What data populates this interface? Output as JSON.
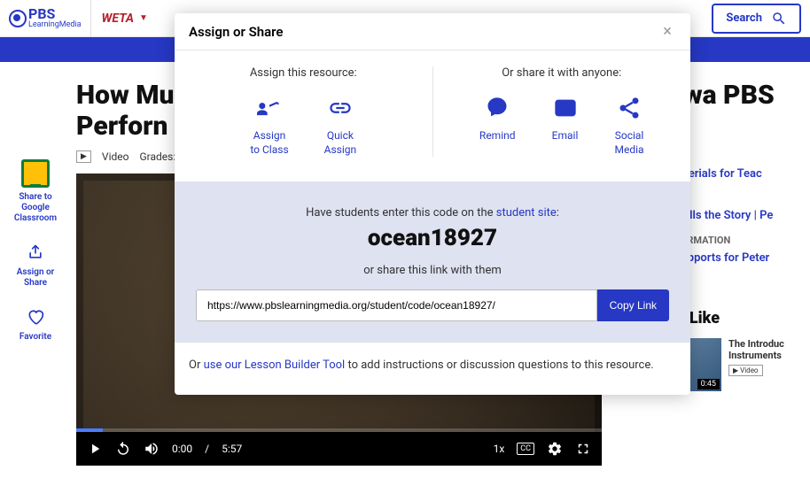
{
  "header": {
    "logo_main": "PBS",
    "logo_sub": "LearningMedia",
    "station": "WETA",
    "search": "Search"
  },
  "page": {
    "title_partial": "How Mu\nPerforn",
    "title_right": "owa PBS",
    "media_type": "Video",
    "grades_label": "Grades: P"
  },
  "left_sidebar": {
    "classroom": "Share to Google Classroom",
    "assign": "Assign or Share",
    "favorite": "Favorite"
  },
  "video": {
    "current_time": "0:00",
    "duration": "5:57",
    "speed": "1x",
    "cc": "CC"
  },
  "right_col": {
    "head1": "Materials for Teac",
    "link1": "c Tells the Story | Pe",
    "head2": "NFORMATION",
    "link2": "l Supports for Peter",
    "like_head": "so Like",
    "like_title": "The Introduc",
    "like_sub": "Instruments",
    "like_dur": "0:45",
    "like_type": "Video"
  },
  "modal": {
    "title": "Assign or Share",
    "col_left_head": "Assign this resource:",
    "col_right_head": "Or share it with anyone:",
    "options": {
      "assign": "Assign\nto Class",
      "quick": "Quick\nAssign",
      "remind": "Remind",
      "email": "Email",
      "social": "Social\nMedia"
    },
    "code_pre": "Have students enter this code on the ",
    "code_link": "student site",
    "code": "ocean18927",
    "share_text": "or share this link with them",
    "url": "https://www.pbslearningmedia.org/student/code/ocean18927/",
    "copy": "Copy Link",
    "foot_pre": "Or ",
    "foot_link": "use our Lesson Builder Tool",
    "foot_post": " to add instructions or discussion questions to this resource."
  }
}
